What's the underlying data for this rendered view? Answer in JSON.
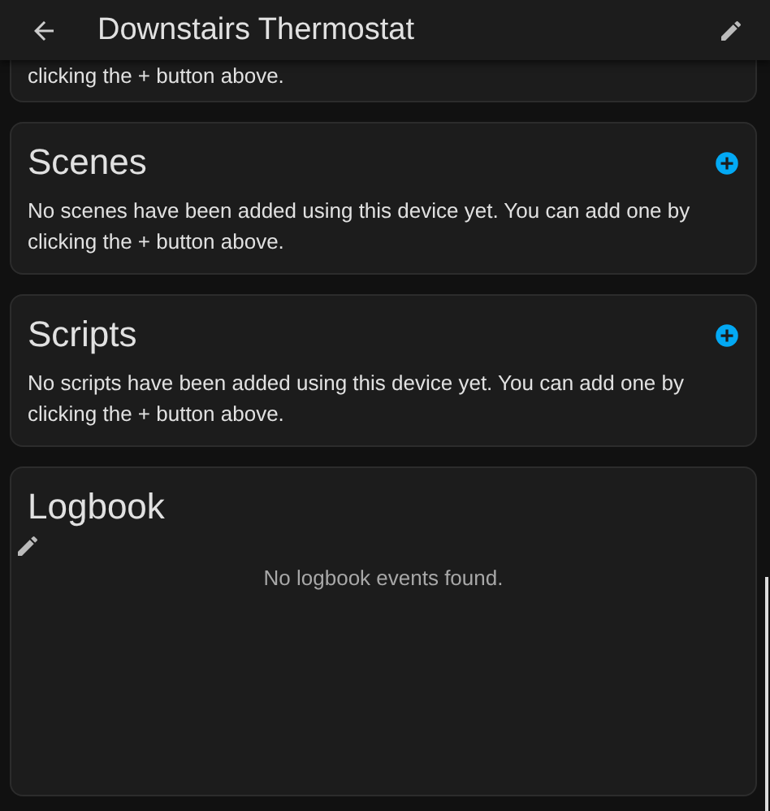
{
  "header": {
    "title": "Downstairs Thermostat"
  },
  "cards": [
    {
      "kind": "partial",
      "text": "clicking the + button above."
    },
    {
      "kind": "section",
      "title": "Scenes",
      "text": "No scenes have been added using this device yet. You can add one by clicking the + button above."
    },
    {
      "kind": "section",
      "title": "Scripts",
      "text": "No scripts have been added using this device yet. You can add one by clicking the + button above."
    },
    {
      "kind": "logbook",
      "title": "Logbook",
      "text": "No logbook events found."
    }
  ]
}
